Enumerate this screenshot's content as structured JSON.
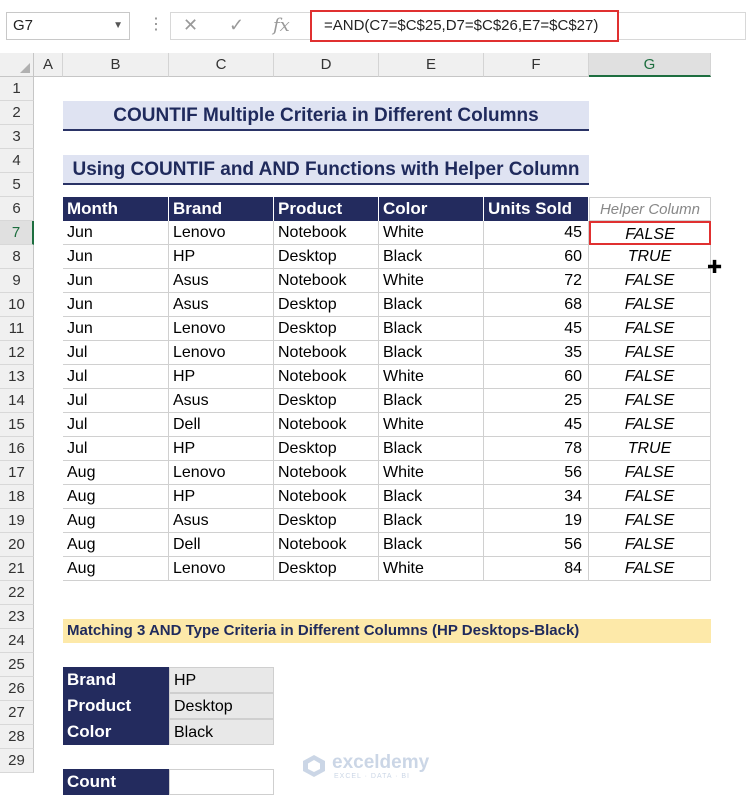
{
  "formula_bar": {
    "name_box": "G7",
    "formula": "=AND(C7=$C$25,D7=$C$26,E7=$C$27)"
  },
  "columns": [
    "A",
    "B",
    "C",
    "D",
    "E",
    "F",
    "G"
  ],
  "rows": [
    "1",
    "2",
    "3",
    "4",
    "5",
    "6",
    "7",
    "8",
    "9",
    "10",
    "11",
    "12",
    "13",
    "14",
    "15",
    "16",
    "17",
    "18",
    "19",
    "20",
    "21",
    "22",
    "23",
    "24",
    "25",
    "26",
    "27",
    "28",
    "29"
  ],
  "titles": {
    "main": "COUNTIF Multiple Criteria in Different Columns",
    "sub": "Using COUNTIF and AND Functions with Helper Column"
  },
  "table": {
    "headers": [
      "Month",
      "Brand",
      "Product",
      "Color",
      "Units Sold"
    ],
    "helper_header": "Helper Column",
    "rows": [
      [
        "Jun",
        "Lenovo",
        "Notebook",
        "White",
        "45",
        "FALSE"
      ],
      [
        "Jun",
        "HP",
        "Desktop",
        "Black",
        "60",
        "TRUE"
      ],
      [
        "Jun",
        "Asus",
        "Notebook",
        "White",
        "72",
        "FALSE"
      ],
      [
        "Jun",
        "Asus",
        "Desktop",
        "Black",
        "68",
        "FALSE"
      ],
      [
        "Jun",
        "Lenovo",
        "Desktop",
        "Black",
        "45",
        "FALSE"
      ],
      [
        "Jul",
        "Lenovo",
        "Notebook",
        "Black",
        "35",
        "FALSE"
      ],
      [
        "Jul",
        "HP",
        "Notebook",
        "White",
        "60",
        "FALSE"
      ],
      [
        "Jul",
        "Asus",
        "Desktop",
        "Black",
        "25",
        "FALSE"
      ],
      [
        "Jul",
        "Dell",
        "Notebook",
        "White",
        "45",
        "FALSE"
      ],
      [
        "Jul",
        "HP",
        "Desktop",
        "Black",
        "78",
        "TRUE"
      ],
      [
        "Aug",
        "Lenovo",
        "Notebook",
        "White",
        "56",
        "FALSE"
      ],
      [
        "Aug",
        "HP",
        "Notebook",
        "Black",
        "34",
        "FALSE"
      ],
      [
        "Aug",
        "Asus",
        "Desktop",
        "Black",
        "19",
        "FALSE"
      ],
      [
        "Aug",
        "Dell",
        "Notebook",
        "Black",
        "56",
        "FALSE"
      ],
      [
        "Aug",
        "Lenovo",
        "Desktop",
        "White",
        "84",
        "FALSE"
      ]
    ]
  },
  "criteria_title": "Matching 3 AND Type Criteria in Different Columns (HP Desktops-Black)",
  "criteria": [
    {
      "label": "Brand",
      "value": "HP"
    },
    {
      "label": "Product",
      "value": "Desktop"
    },
    {
      "label": "Color",
      "value": "Black"
    }
  ],
  "count": {
    "label": "Count",
    "value": ""
  },
  "watermark": {
    "name": "exceldemy",
    "tag": "EXCEL · DATA · BI"
  },
  "icons": {
    "cancel": "✕",
    "confirm": "✓",
    "function": "fx"
  },
  "colors": {
    "header_bg": "#232b5e",
    "title_bg": "#dfe3f2",
    "highlight": "#e03030",
    "criteria_bg": "#fde9a9",
    "selection": "#1d6e3f"
  }
}
